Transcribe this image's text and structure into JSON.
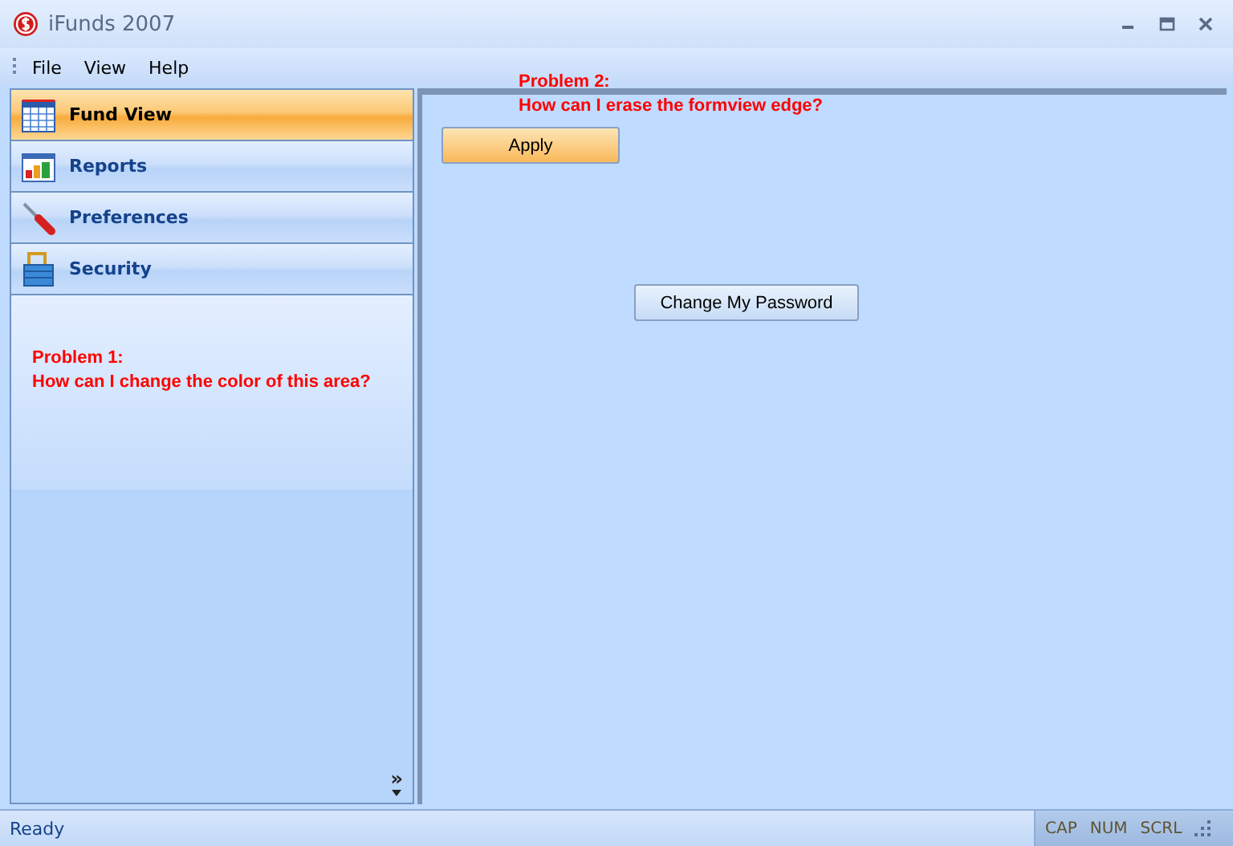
{
  "window": {
    "title": "iFunds 2007"
  },
  "menu": [
    {
      "label": "File"
    },
    {
      "label": "View"
    },
    {
      "label": "Help"
    }
  ],
  "nav": [
    {
      "label": "Fund View",
      "kind": "calendar",
      "selected": true
    },
    {
      "label": "Reports",
      "kind": "chart",
      "selected": false
    },
    {
      "label": "Preferences",
      "kind": "screwdriver",
      "selected": false
    },
    {
      "label": "Security",
      "kind": "lock",
      "selected": false
    }
  ],
  "left_note": {
    "title": "Problem 1:",
    "text": "How can I change the color of this area?"
  },
  "nav_overflow": "»",
  "right_note": {
    "title": "Problem 2:",
    "text": "How can I erase the formview edge?"
  },
  "apply_button": "Apply",
  "password_button": "Change My Password",
  "status_bar": {
    "text": "Ready",
    "indicators": [
      {
        "label": "CAP",
        "disabled": true
      },
      {
        "label": "NUM",
        "disabled": true
      },
      {
        "label": "SCRL",
        "disabled": true
      }
    ]
  }
}
